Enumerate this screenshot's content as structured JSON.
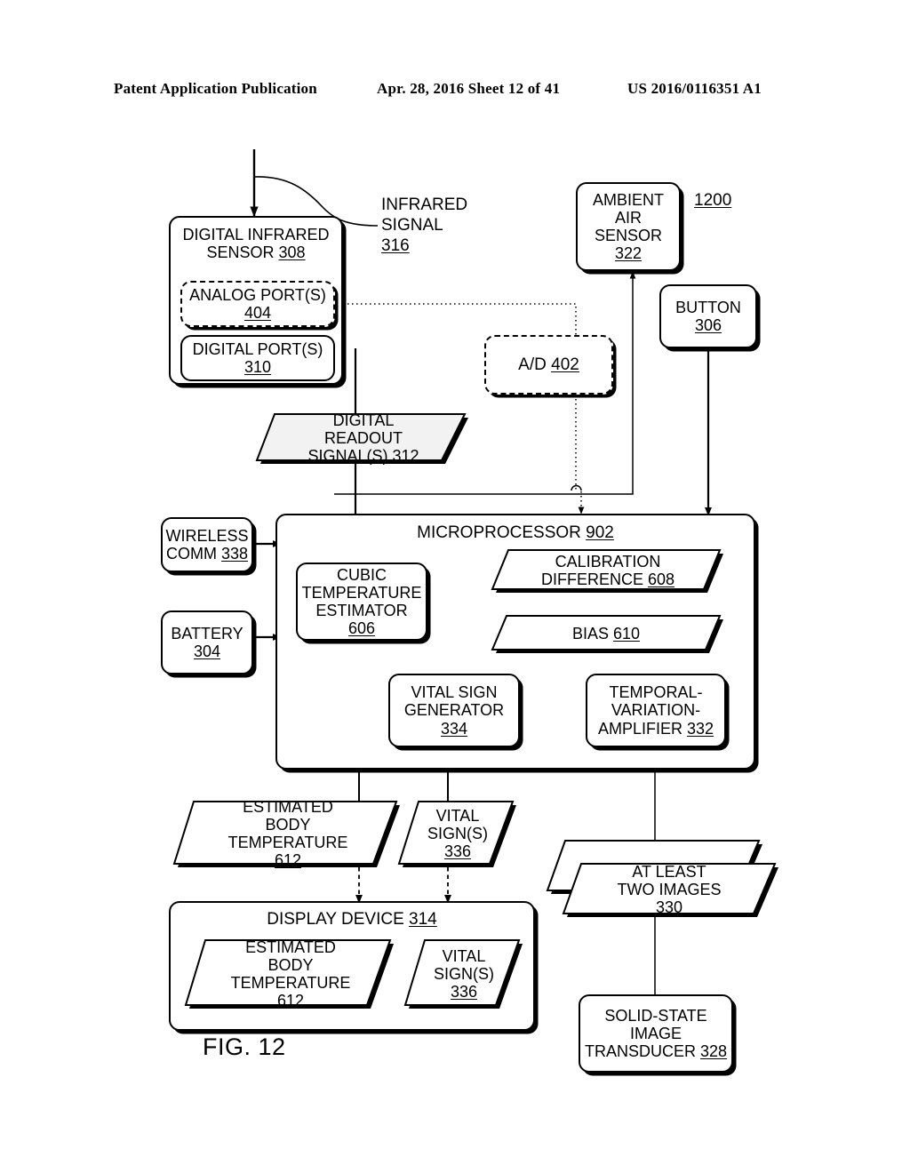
{
  "header": {
    "publication": "Patent Application Publication",
    "date_sheet": "Apr. 28, 2016  Sheet 12 of 41",
    "number": "US 2016/0116351 A1"
  },
  "figure": {
    "caption": "FIG. 12",
    "system_ref": "1200"
  },
  "nodes": {
    "digital_infrared_sensor": {
      "title": "DIGITAL INFRARED",
      "title2": "SENSOR",
      "ref": "308"
    },
    "analog_ports": {
      "title": "ANALOG PORT(S)",
      "ref": "404"
    },
    "digital_ports": {
      "title": "DIGITAL PORT(S)",
      "ref": "310"
    },
    "infrared_signal": {
      "line1": "INFRARED",
      "line2": "SIGNAL",
      "ref": "316"
    },
    "ambient_air_sensor": {
      "line1": "AMBIENT",
      "line2": "AIR",
      "line3": "SENSOR",
      "ref": "322"
    },
    "button": {
      "title": "BUTTON",
      "ref": "306"
    },
    "ad_converter": {
      "title": "A/D",
      "ref": "402"
    },
    "digital_readout_signal": {
      "line1": "DIGITAL",
      "line2": "READOUT",
      "line3": "SIGNAL(S)",
      "ref": "312"
    },
    "microprocessor": {
      "title": "MICROPROCESSOR",
      "ref": "902"
    },
    "wireless_comm": {
      "line1": "WIRELESS",
      "line2": "COMM",
      "ref": "338"
    },
    "battery": {
      "title": "BATTERY",
      "ref": "304"
    },
    "cubic_temperature_estimator": {
      "line1": "CUBIC",
      "line2": "TEMPERATURE",
      "line3": "ESTIMATOR",
      "ref": "606"
    },
    "calibration_difference": {
      "line1": "CALIBRATION",
      "line2": "DIFFERENCE",
      "ref": "608"
    },
    "bias": {
      "title": "BIAS",
      "ref": "610"
    },
    "vital_sign_generator": {
      "line1": "VITAL SIGN",
      "line2": "GENERATOR",
      "ref": "334"
    },
    "temporal_variation_amplifier": {
      "line1": "TEMPORAL-",
      "line2": "VARIATION-",
      "line3": "AMPLIFIER",
      "ref": "332"
    },
    "estimated_body_temperature": {
      "line1": "ESTIMATED",
      "line2": "BODY",
      "line3": "TEMPERATURE",
      "ref": "612"
    },
    "vital_signs": {
      "line1": "VITAL",
      "line2": "SIGN(S)",
      "ref": "336"
    },
    "at_least_two_images": {
      "line1": "AT LEAST",
      "line2": "TWO IMAGES",
      "ref": "330"
    },
    "display_device": {
      "title": "DISPLAY DEVICE",
      "ref": "314"
    },
    "display_estimated_body_temperature": {
      "line1": "ESTIMATED",
      "line2": "BODY",
      "line3": "TEMPERATURE",
      "ref": "612"
    },
    "display_vital_signs": {
      "line1": "VITAL",
      "line2": "SIGN(S)",
      "ref": "336"
    },
    "solid_state_image_transducer": {
      "line1": "SOLID-STATE",
      "line2": "IMAGE",
      "line3": "TRANSDUCER",
      "ref": "328"
    }
  },
  "colors": {
    "ink": "#000000",
    "paper": "#ffffff",
    "signal_fill": "#f2f2f2"
  }
}
